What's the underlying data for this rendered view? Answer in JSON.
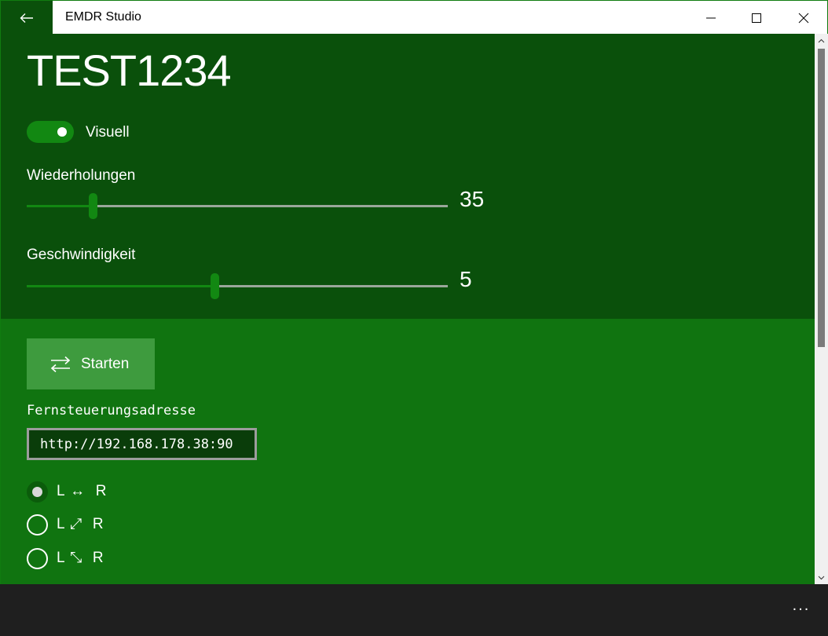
{
  "window": {
    "title": "EMDR Studio"
  },
  "page": {
    "heading": "TEST1234"
  },
  "visual_toggle": {
    "label": "Visuell",
    "on": true
  },
  "repetitions": {
    "label": "Wiederholungen",
    "value": "35",
    "fill_fraction": 0.157
  },
  "speed": {
    "label": "Geschwindigkeit",
    "value": "5",
    "fill_fraction": 0.446
  },
  "start_button": {
    "label": "Starten",
    "icon": "swap-arrows-icon"
  },
  "remote": {
    "label": "Fernsteuerungsadresse",
    "value": "http://192.168.178.38:90"
  },
  "direction_options": [
    {
      "label_left": "L",
      "arrow": "↔",
      "label_right": "R",
      "selected": true
    },
    {
      "label_left": "L",
      "arrow": "⤢",
      "label_right": "R",
      "selected": false
    },
    {
      "label_left": "L",
      "arrow": "⤡",
      "label_right": "R",
      "selected": false
    }
  ],
  "command_bar": {
    "more_label": "..."
  },
  "colors": {
    "top_panel": "#0a500b",
    "bottom_panel": "#107410",
    "accent": "#128812"
  }
}
